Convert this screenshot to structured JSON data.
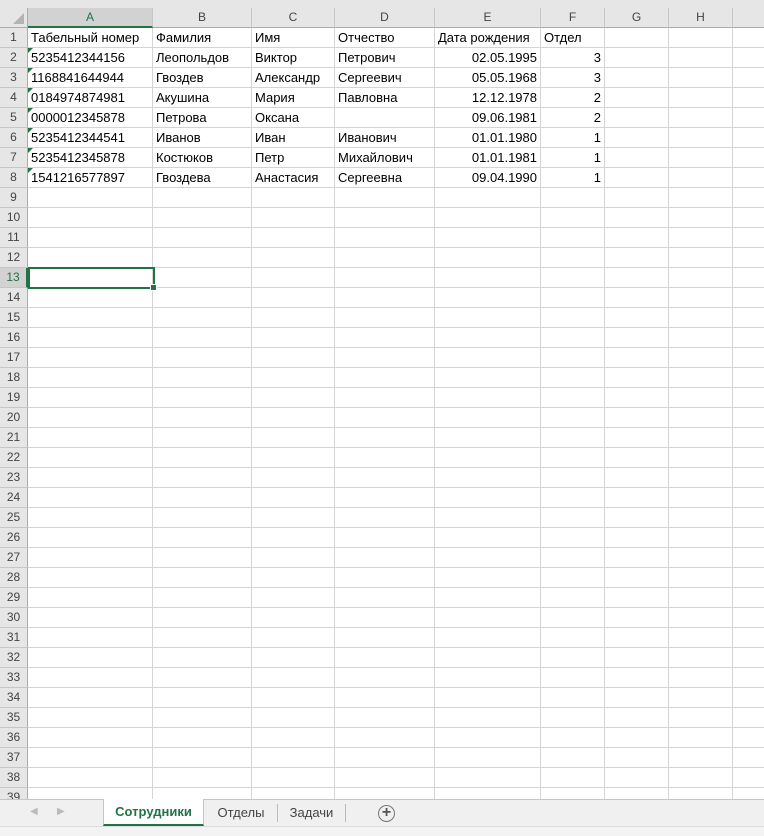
{
  "columns": [
    "A",
    "B",
    "C",
    "D",
    "E",
    "F",
    "G",
    "H"
  ],
  "row_count": 39,
  "selected_cell": "A13",
  "rows": [
    [
      "Табельный номер",
      "Фамилия",
      "Имя",
      "Отчество",
      "Дата рождения",
      "Отдел"
    ],
    [
      "5235412344156",
      "Леопольдов",
      "Виктор",
      "Петрович",
      "02.05.1995",
      "3"
    ],
    [
      "1168841644944",
      "Гвоздев",
      "Александр",
      "Сергеевич",
      "05.05.1968",
      "3"
    ],
    [
      "0184974874981",
      "Акушина",
      "Мария",
      "Павловна",
      "12.12.1978",
      "2"
    ],
    [
      "0000012345878",
      "Петрова",
      "Оксана",
      "",
      "09.06.1981",
      "2"
    ],
    [
      "5235412344541",
      "Иванов",
      "Иван",
      "Иванович",
      "01.01.1980",
      "1"
    ],
    [
      "5235412345878",
      "Костюков",
      "Петр",
      "Михайлович",
      "01.01.1981",
      "1"
    ],
    [
      "1541216577897",
      "Гвоздева",
      "Анастасия",
      "Сергеевна",
      "09.04.1990",
      "1"
    ]
  ],
  "tabs": [
    {
      "label": "Сотрудники",
      "active": true
    },
    {
      "label": "Отделы"
    },
    {
      "label": "Задачи"
    }
  ],
  "accent": "#217346"
}
